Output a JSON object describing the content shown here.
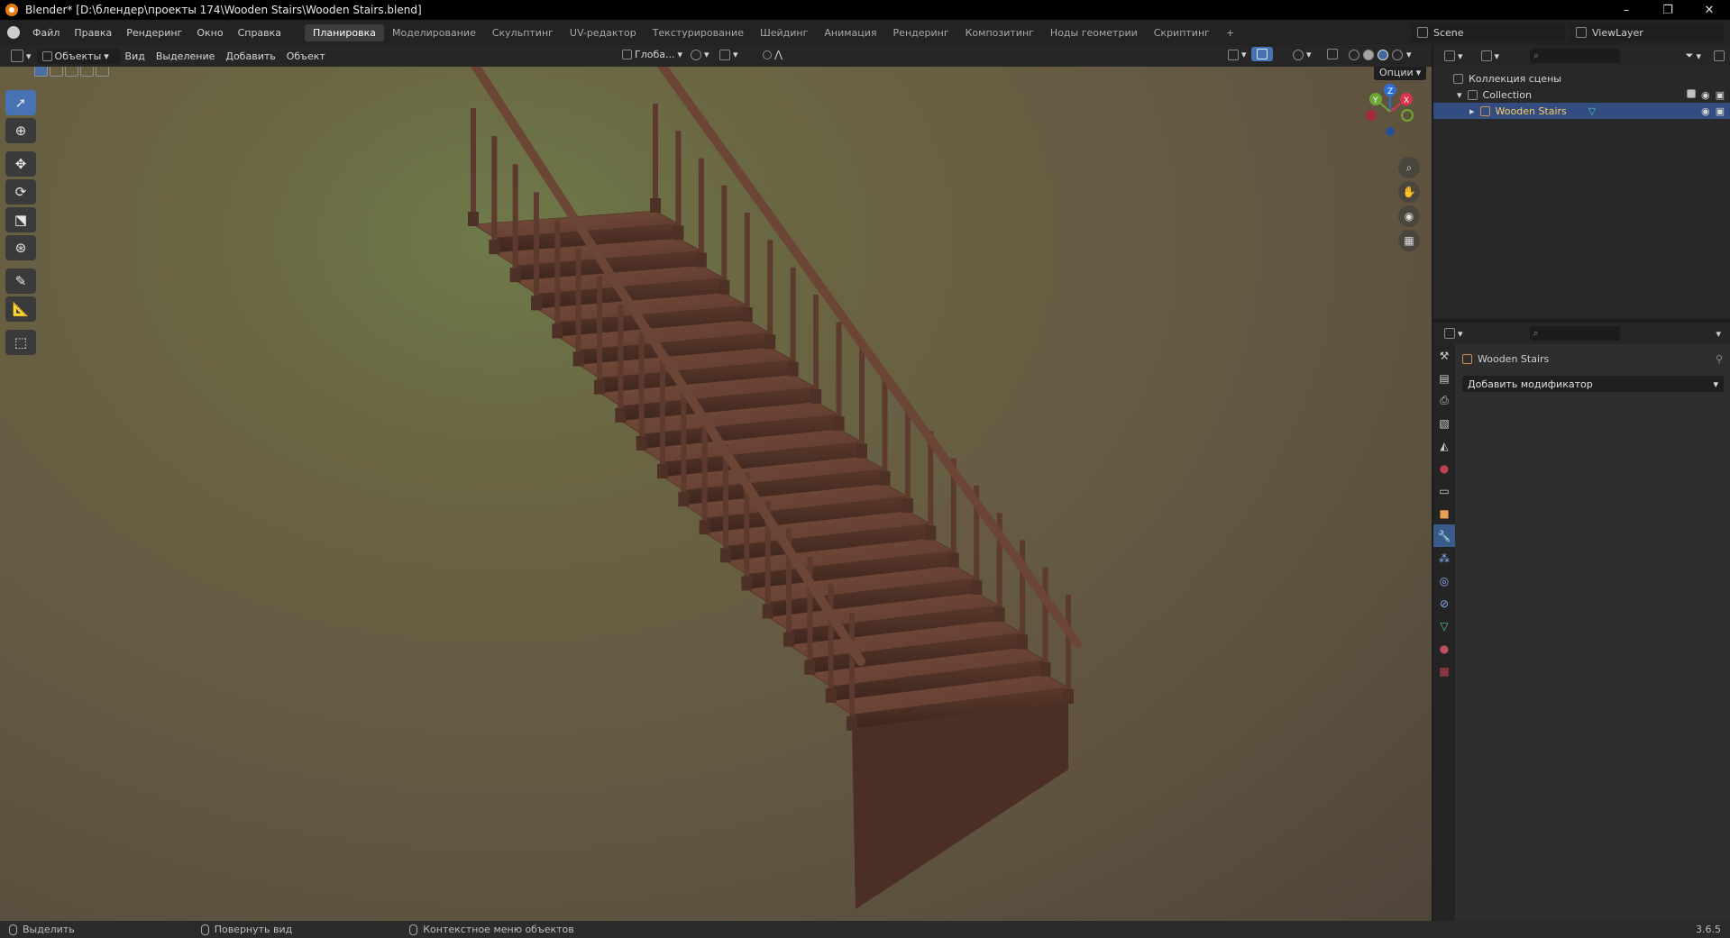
{
  "window": {
    "title": "Blender* [D:\\блендер\\проекты 174\\Wooden Stairs\\Wooden Stairs.blend]",
    "minimize": "–",
    "maximize": "❐",
    "close": "✕"
  },
  "menus": [
    "Файл",
    "Правка",
    "Рендеринг",
    "Окно",
    "Справка"
  ],
  "workspaces": [
    "Планировка",
    "Моделирование",
    "Скульптинг",
    "UV-редактор",
    "Текстурирование",
    "Шейдинг",
    "Анимация",
    "Рендеринг",
    "Композитинг",
    "Ноды геометрии",
    "Скриптинг"
  ],
  "workspace_add": "+",
  "scene": {
    "name": "Scene"
  },
  "viewlayer": {
    "name": "ViewLayer"
  },
  "viewport_header": {
    "mode": "Объекты",
    "view": "Вид",
    "select": "Выделение",
    "add": "Добавить",
    "object": "Объект",
    "orientation": "Глоба...",
    "options": "Опции"
  },
  "gizmo": {
    "z": "Z",
    "y": "Y",
    "x": "X"
  },
  "outliner": {
    "root": "Коллекция сцены",
    "collection": "Collection",
    "object": "Wooden Stairs"
  },
  "properties": {
    "object_name": "Wooden Stairs",
    "add_modifier": "Добавить модификатор"
  },
  "statusbar": {
    "select": "Выделить",
    "rotate": "Повернуть вид",
    "context": "Контекстное меню объектов",
    "version": "3.6.5"
  },
  "colors": {
    "accent": "#4772b3",
    "selection": "#334d80",
    "orange": "#e87d0d"
  }
}
